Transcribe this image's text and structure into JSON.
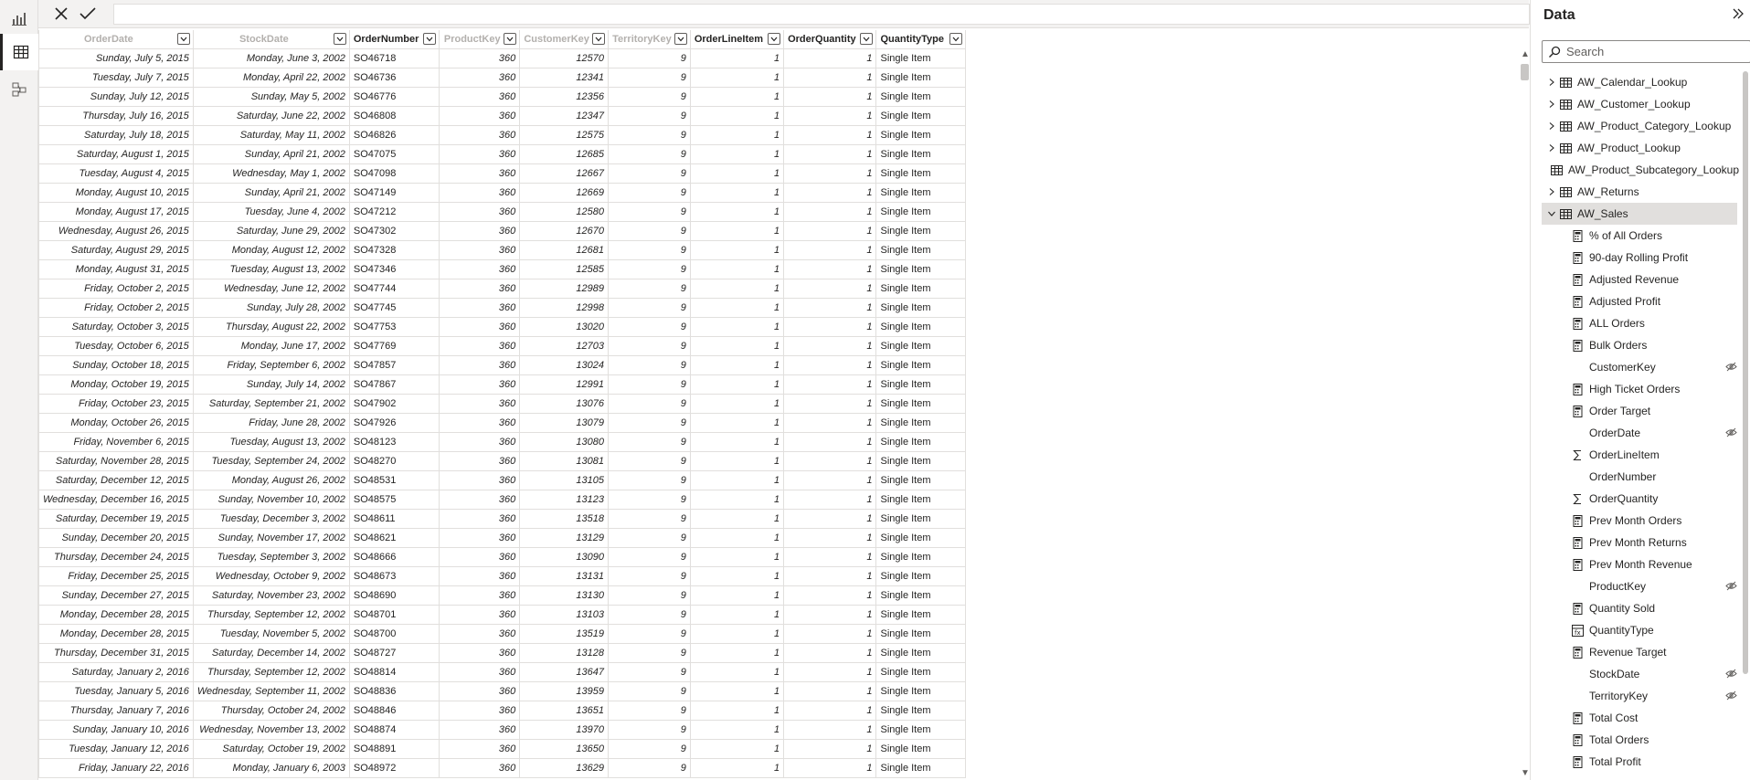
{
  "formula_bar": {
    "cancel_icon": "close-icon",
    "commit_icon": "check-icon",
    "value": ""
  },
  "grid": {
    "columns": [
      "OrderDate",
      "StockDate",
      "OrderNumber",
      "ProductKey",
      "CustomerKey",
      "TerritoryKey",
      "OrderLineItem",
      "OrderQuantity",
      "QuantityType"
    ],
    "rows": [
      [
        "Sunday, July 5, 2015",
        "Monday, June 3, 2002",
        "SO46718",
        "360",
        "12570",
        "9",
        "1",
        "1",
        "Single Item"
      ],
      [
        "Tuesday, July 7, 2015",
        "Monday, April 22, 2002",
        "SO46736",
        "360",
        "12341",
        "9",
        "1",
        "1",
        "Single Item"
      ],
      [
        "Sunday, July 12, 2015",
        "Sunday, May 5, 2002",
        "SO46776",
        "360",
        "12356",
        "9",
        "1",
        "1",
        "Single Item"
      ],
      [
        "Thursday, July 16, 2015",
        "Saturday, June 22, 2002",
        "SO46808",
        "360",
        "12347",
        "9",
        "1",
        "1",
        "Single Item"
      ],
      [
        "Saturday, July 18, 2015",
        "Saturday, May 11, 2002",
        "SO46826",
        "360",
        "12575",
        "9",
        "1",
        "1",
        "Single Item"
      ],
      [
        "Saturday, August 1, 2015",
        "Sunday, April 21, 2002",
        "SO47075",
        "360",
        "12685",
        "9",
        "1",
        "1",
        "Single Item"
      ],
      [
        "Tuesday, August 4, 2015",
        "Wednesday, May 1, 2002",
        "SO47098",
        "360",
        "12667",
        "9",
        "1",
        "1",
        "Single Item"
      ],
      [
        "Monday, August 10, 2015",
        "Sunday, April 21, 2002",
        "SO47149",
        "360",
        "12669",
        "9",
        "1",
        "1",
        "Single Item"
      ],
      [
        "Monday, August 17, 2015",
        "Tuesday, June 4, 2002",
        "SO47212",
        "360",
        "12580",
        "9",
        "1",
        "1",
        "Single Item"
      ],
      [
        "Wednesday, August 26, 2015",
        "Saturday, June 29, 2002",
        "SO47302",
        "360",
        "12670",
        "9",
        "1",
        "1",
        "Single Item"
      ],
      [
        "Saturday, August 29, 2015",
        "Monday, August 12, 2002",
        "SO47328",
        "360",
        "12681",
        "9",
        "1",
        "1",
        "Single Item"
      ],
      [
        "Monday, August 31, 2015",
        "Tuesday, August 13, 2002",
        "SO47346",
        "360",
        "12585",
        "9",
        "1",
        "1",
        "Single Item"
      ],
      [
        "Friday, October 2, 2015",
        "Wednesday, June 12, 2002",
        "SO47744",
        "360",
        "12989",
        "9",
        "1",
        "1",
        "Single Item"
      ],
      [
        "Friday, October 2, 2015",
        "Sunday, July 28, 2002",
        "SO47745",
        "360",
        "12998",
        "9",
        "1",
        "1",
        "Single Item"
      ],
      [
        "Saturday, October 3, 2015",
        "Thursday, August 22, 2002",
        "SO47753",
        "360",
        "13020",
        "9",
        "1",
        "1",
        "Single Item"
      ],
      [
        "Tuesday, October 6, 2015",
        "Monday, June 17, 2002",
        "SO47769",
        "360",
        "12703",
        "9",
        "1",
        "1",
        "Single Item"
      ],
      [
        "Sunday, October 18, 2015",
        "Friday, September 6, 2002",
        "SO47857",
        "360",
        "13024",
        "9",
        "1",
        "1",
        "Single Item"
      ],
      [
        "Monday, October 19, 2015",
        "Sunday, July 14, 2002",
        "SO47867",
        "360",
        "12991",
        "9",
        "1",
        "1",
        "Single Item"
      ],
      [
        "Friday, October 23, 2015",
        "Saturday, September 21, 2002",
        "SO47902",
        "360",
        "13076",
        "9",
        "1",
        "1",
        "Single Item"
      ],
      [
        "Monday, October 26, 2015",
        "Friday, June 28, 2002",
        "SO47926",
        "360",
        "13079",
        "9",
        "1",
        "1",
        "Single Item"
      ],
      [
        "Friday, November 6, 2015",
        "Tuesday, August 13, 2002",
        "SO48123",
        "360",
        "13080",
        "9",
        "1",
        "1",
        "Single Item"
      ],
      [
        "Saturday, November 28, 2015",
        "Tuesday, September 24, 2002",
        "SO48270",
        "360",
        "13081",
        "9",
        "1",
        "1",
        "Single Item"
      ],
      [
        "Saturday, December 12, 2015",
        "Monday, August 26, 2002",
        "SO48531",
        "360",
        "13105",
        "9",
        "1",
        "1",
        "Single Item"
      ],
      [
        "Wednesday, December 16, 2015",
        "Sunday, November 10, 2002",
        "SO48575",
        "360",
        "13123",
        "9",
        "1",
        "1",
        "Single Item"
      ],
      [
        "Saturday, December 19, 2015",
        "Tuesday, December 3, 2002",
        "SO48611",
        "360",
        "13518",
        "9",
        "1",
        "1",
        "Single Item"
      ],
      [
        "Sunday, December 20, 2015",
        "Sunday, November 17, 2002",
        "SO48621",
        "360",
        "13129",
        "9",
        "1",
        "1",
        "Single Item"
      ],
      [
        "Thursday, December 24, 2015",
        "Tuesday, September 3, 2002",
        "SO48666",
        "360",
        "13090",
        "9",
        "1",
        "1",
        "Single Item"
      ],
      [
        "Friday, December 25, 2015",
        "Wednesday, October 9, 2002",
        "SO48673",
        "360",
        "13131",
        "9",
        "1",
        "1",
        "Single Item"
      ],
      [
        "Sunday, December 27, 2015",
        "Saturday, November 23, 2002",
        "SO48690",
        "360",
        "13130",
        "9",
        "1",
        "1",
        "Single Item"
      ],
      [
        "Monday, December 28, 2015",
        "Thursday, September 12, 2002",
        "SO48701",
        "360",
        "13103",
        "9",
        "1",
        "1",
        "Single Item"
      ],
      [
        "Monday, December 28, 2015",
        "Tuesday, November 5, 2002",
        "SO48700",
        "360",
        "13519",
        "9",
        "1",
        "1",
        "Single Item"
      ],
      [
        "Thursday, December 31, 2015",
        "Saturday, December 14, 2002",
        "SO48727",
        "360",
        "13128",
        "9",
        "1",
        "1",
        "Single Item"
      ],
      [
        "Saturday, January 2, 2016",
        "Thursday, September 12, 2002",
        "SO48814",
        "360",
        "13647",
        "9",
        "1",
        "1",
        "Single Item"
      ],
      [
        "Tuesday, January 5, 2016",
        "Wednesday, September 11, 2002",
        "SO48836",
        "360",
        "13959",
        "9",
        "1",
        "1",
        "Single Item"
      ],
      [
        "Thursday, January 7, 2016",
        "Thursday, October 24, 2002",
        "SO48846",
        "360",
        "13651",
        "9",
        "1",
        "1",
        "Single Item"
      ],
      [
        "Sunday, January 10, 2016",
        "Wednesday, November 13, 2002",
        "SO48874",
        "360",
        "13970",
        "9",
        "1",
        "1",
        "Single Item"
      ],
      [
        "Tuesday, January 12, 2016",
        "Saturday, October 19, 2002",
        "SO48891",
        "360",
        "13650",
        "9",
        "1",
        "1",
        "Single Item"
      ],
      [
        "Friday, January 22, 2016",
        "Monday, January 6, 2003",
        "SO48972",
        "360",
        "13629",
        "9",
        "1",
        "1",
        "Single Item"
      ]
    ]
  },
  "pane": {
    "title": "Data",
    "collapse_icon": "double-chevron-right-icon",
    "search_placeholder": "Search",
    "tables": [
      {
        "label": "AW_Calendar_Lookup"
      },
      {
        "label": "AW_Customer_Lookup"
      },
      {
        "label": "AW_Product_Category_Lookup"
      },
      {
        "label": "AW_Product_Lookup"
      },
      {
        "label": "AW_Product_Subcategory_Lookup"
      },
      {
        "label": "AW_Returns"
      },
      {
        "label": "AW_Sales"
      }
    ],
    "fields": [
      {
        "label": "% of All Orders",
        "icon": "calculator-icon"
      },
      {
        "label": "90-day Rolling Profit",
        "icon": "calculator-icon"
      },
      {
        "label": "Adjusted Revenue",
        "icon": "calculator-icon"
      },
      {
        "label": "Adjusted Profit",
        "icon": "calculator-icon"
      },
      {
        "label": "ALL Orders",
        "icon": "calculator-icon"
      },
      {
        "label": "Bulk Orders",
        "icon": "calculator-icon"
      },
      {
        "label": "CustomerKey",
        "icon": "none",
        "hidden": true
      },
      {
        "label": "High Ticket Orders",
        "icon": "calculator-icon"
      },
      {
        "label": "Order Target",
        "icon": "calculator-icon"
      },
      {
        "label": "OrderDate",
        "icon": "none",
        "hidden": true
      },
      {
        "label": "OrderLineItem",
        "icon": "sigma-icon"
      },
      {
        "label": "OrderNumber",
        "icon": "none"
      },
      {
        "label": "OrderQuantity",
        "icon": "sigma-icon"
      },
      {
        "label": "Prev Month Orders",
        "icon": "calculator-icon"
      },
      {
        "label": "Prev Month Returns",
        "icon": "calculator-icon"
      },
      {
        "label": "Prev Month Revenue",
        "icon": "calculator-icon"
      },
      {
        "label": "ProductKey",
        "icon": "none",
        "hidden": true
      },
      {
        "label": "Quantity Sold",
        "icon": "calculator-icon"
      },
      {
        "label": "QuantityType",
        "icon": "calculated-column-icon"
      },
      {
        "label": "Revenue Target",
        "icon": "calculator-icon"
      },
      {
        "label": "StockDate",
        "icon": "none",
        "hidden": true
      },
      {
        "label": "TerritoryKey",
        "icon": "none",
        "hidden": true
      },
      {
        "label": "Total Cost",
        "icon": "calculator-icon"
      },
      {
        "label": "Total Orders",
        "icon": "calculator-icon"
      },
      {
        "label": "Total Profit",
        "icon": "calculator-icon"
      }
    ]
  }
}
